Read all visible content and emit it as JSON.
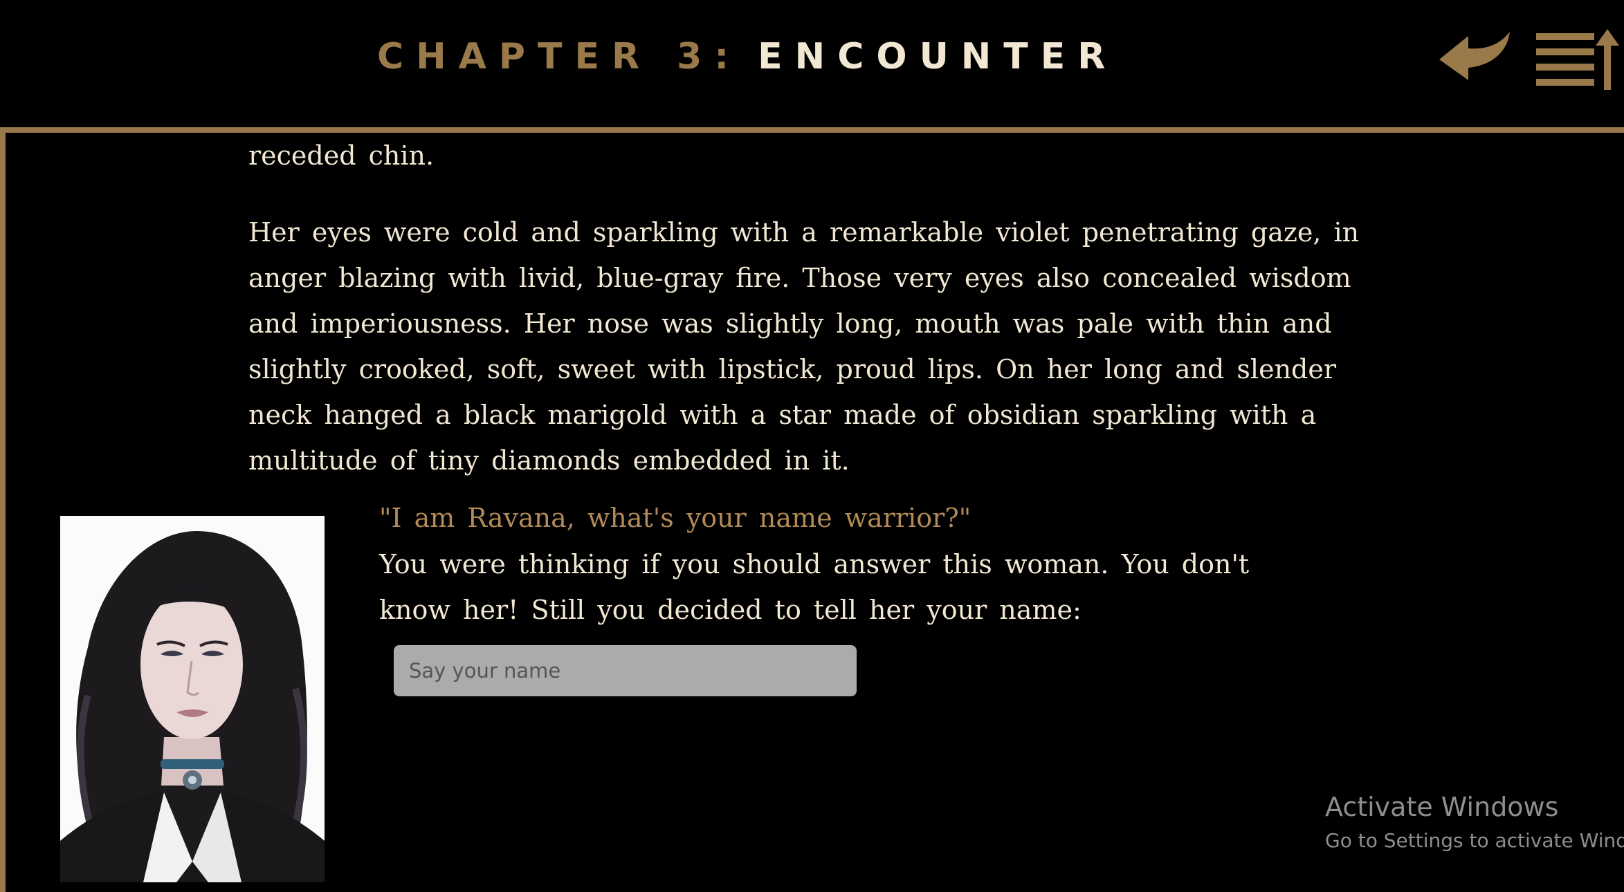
{
  "header": {
    "chapter_label": "CHAPTER 3:",
    "chapter_name": "ENCOUNTER",
    "back_icon": "back-arrow-icon",
    "menu_icon": "chapter-list-icon"
  },
  "story": {
    "paragraph_1": "receded chin.",
    "paragraph_2": "Her eyes were cold and sparkling with a remarkable violet penetrating gaze, in anger blazing with livid, blue-gray fire. Those very eyes also concealed wisdom and imperiousness. Her nose was slightly long, mouth was pale with thin and slightly crooked, soft, sweet with lipstick, proud lips. On her long and slender neck hanged a black marigold with a star made of obsidian sparkling with a multitude of tiny diamonds embedded in it."
  },
  "dialogue": {
    "quote": "\"I am Ravana, what's your name warrior?\"",
    "narration": "You were thinking if you should answer this woman. You don't know her! Still you decided to tell her your name:"
  },
  "name_input": {
    "placeholder": "Say your name",
    "value": ""
  },
  "system": {
    "activate_title": "Activate Windows",
    "activate_subtitle": "Go to Settings to activate Windows."
  },
  "colors": {
    "accent_gold": "#9a7a4a",
    "quote_gold": "#b38a57",
    "text_cream": "#f1e7d2",
    "background": "#000000",
    "input_bg": "#ababab"
  }
}
